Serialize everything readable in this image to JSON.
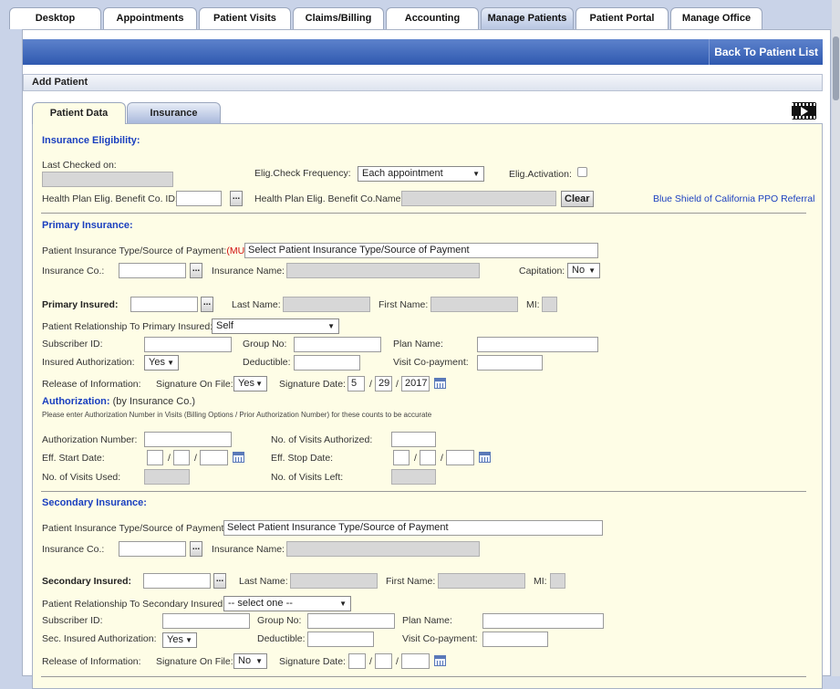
{
  "nav": {
    "tabs": [
      "Desktop",
      "Appointments",
      "Patient Visits",
      "Claims/Billing",
      "Accounting",
      "Manage Patients",
      "Patient Portal",
      "Manage Office"
    ],
    "active": "Manage Patients"
  },
  "header": {
    "back_label": "Back To Patient List",
    "page_title": "Add Patient"
  },
  "subtabs": {
    "patient_data": "Patient Data",
    "insurance": "Insurance"
  },
  "elig": {
    "section_title": "Insurance Eligibility:",
    "last_checked_label": "Last Checked on:",
    "frequency_label": "Elig.Check Frequency:",
    "frequency_value": "Each appointment",
    "activation_label": "Elig.Activation:",
    "benefit_id_label": "Health Plan Elig. Benefit Co. ID:",
    "benefit_name_label": "Health Plan Elig. Benefit Co.Name:",
    "clear_label": "Clear",
    "referral_link": "Blue Shield of California PPO Referral"
  },
  "primary": {
    "section_title": "Primary Insurance:",
    "type_label": "Patient Insurance Type/Source of Payment:",
    "mu_tag": "(MU)",
    "type_value": "Select Patient Insurance Type/Source of Payment",
    "ins_co_label": "Insurance Co.:",
    "ins_name_label": "Insurance Name:",
    "capitation_label": "Capitation:",
    "capitation_value": "No",
    "insured_label": "Primary Insured:",
    "last_name_label": "Last Name:",
    "first_name_label": "First Name:",
    "mi_label": "MI:",
    "relationship_label": "Patient Relationship To Primary Insured:",
    "relationship_value": "Self",
    "subscriber_label": "Subscriber ID:",
    "group_label": "Group No:",
    "plan_label": "Plan Name:",
    "auth_label": "Insured Authorization:",
    "auth_value": "Yes",
    "deductible_label": "Deductible:",
    "copay_label": "Visit Co-payment:",
    "release_label": "Release of Information:",
    "sig_on_file_label": "Signature On File:",
    "sig_on_file_value": "Yes",
    "sig_date_label": "Signature Date:",
    "sig_month": "5",
    "sig_day": "29",
    "sig_year": "2017",
    "date_sep": "/"
  },
  "authorization": {
    "title": "Authorization:",
    "subtitle": "(by Insurance Co.)",
    "note": "Please enter Authorization Number in Visits (Billing Options / Prior Authorization Number) for these counts to be accurate",
    "number_label": "Authorization Number:",
    "visits_authorized_label": "No. of Visits Authorized:",
    "start_label": "Eff. Start Date:",
    "stop_label": "Eff. Stop Date:",
    "visits_used_label": "No. of Visits Used:",
    "visits_left_label": "No. of Visits Left:"
  },
  "secondary": {
    "section_title": "Secondary Insurance:",
    "type_label": "Patient Insurance Type/Source of Payment:",
    "type_value": "Select Patient Insurance Type/Source of Payment",
    "ins_co_label": "Insurance Co.:",
    "ins_name_label": "Insurance Name:",
    "insured_label": "Secondary Insured:",
    "last_name_label": "Last Name:",
    "first_name_label": "First Name:",
    "mi_label": "MI:",
    "relationship_label": "Patient Relationship To Secondary Insured:",
    "relationship_value": "-- select one --",
    "subscriber_label": "Subscriber ID:",
    "group_label": "Group No:",
    "plan_label": "Plan Name:",
    "auth_label": "Sec. Insured Authorization:",
    "auth_value": "Yes",
    "deductible_label": "Deductible:",
    "copay_label": "Visit Co-payment:",
    "release_label": "Release of Information:",
    "sig_on_file_label": "Signature On File:",
    "sig_on_file_value": "No",
    "sig_date_label": "Signature Date:"
  },
  "ui": {
    "dots": "...",
    "caret": "▼"
  },
  "colors": {
    "accent_blue": "#2f59b0",
    "panel_bg": "#fefde6",
    "section_title": "#1a3fbf",
    "mu_red": "#d01010"
  }
}
